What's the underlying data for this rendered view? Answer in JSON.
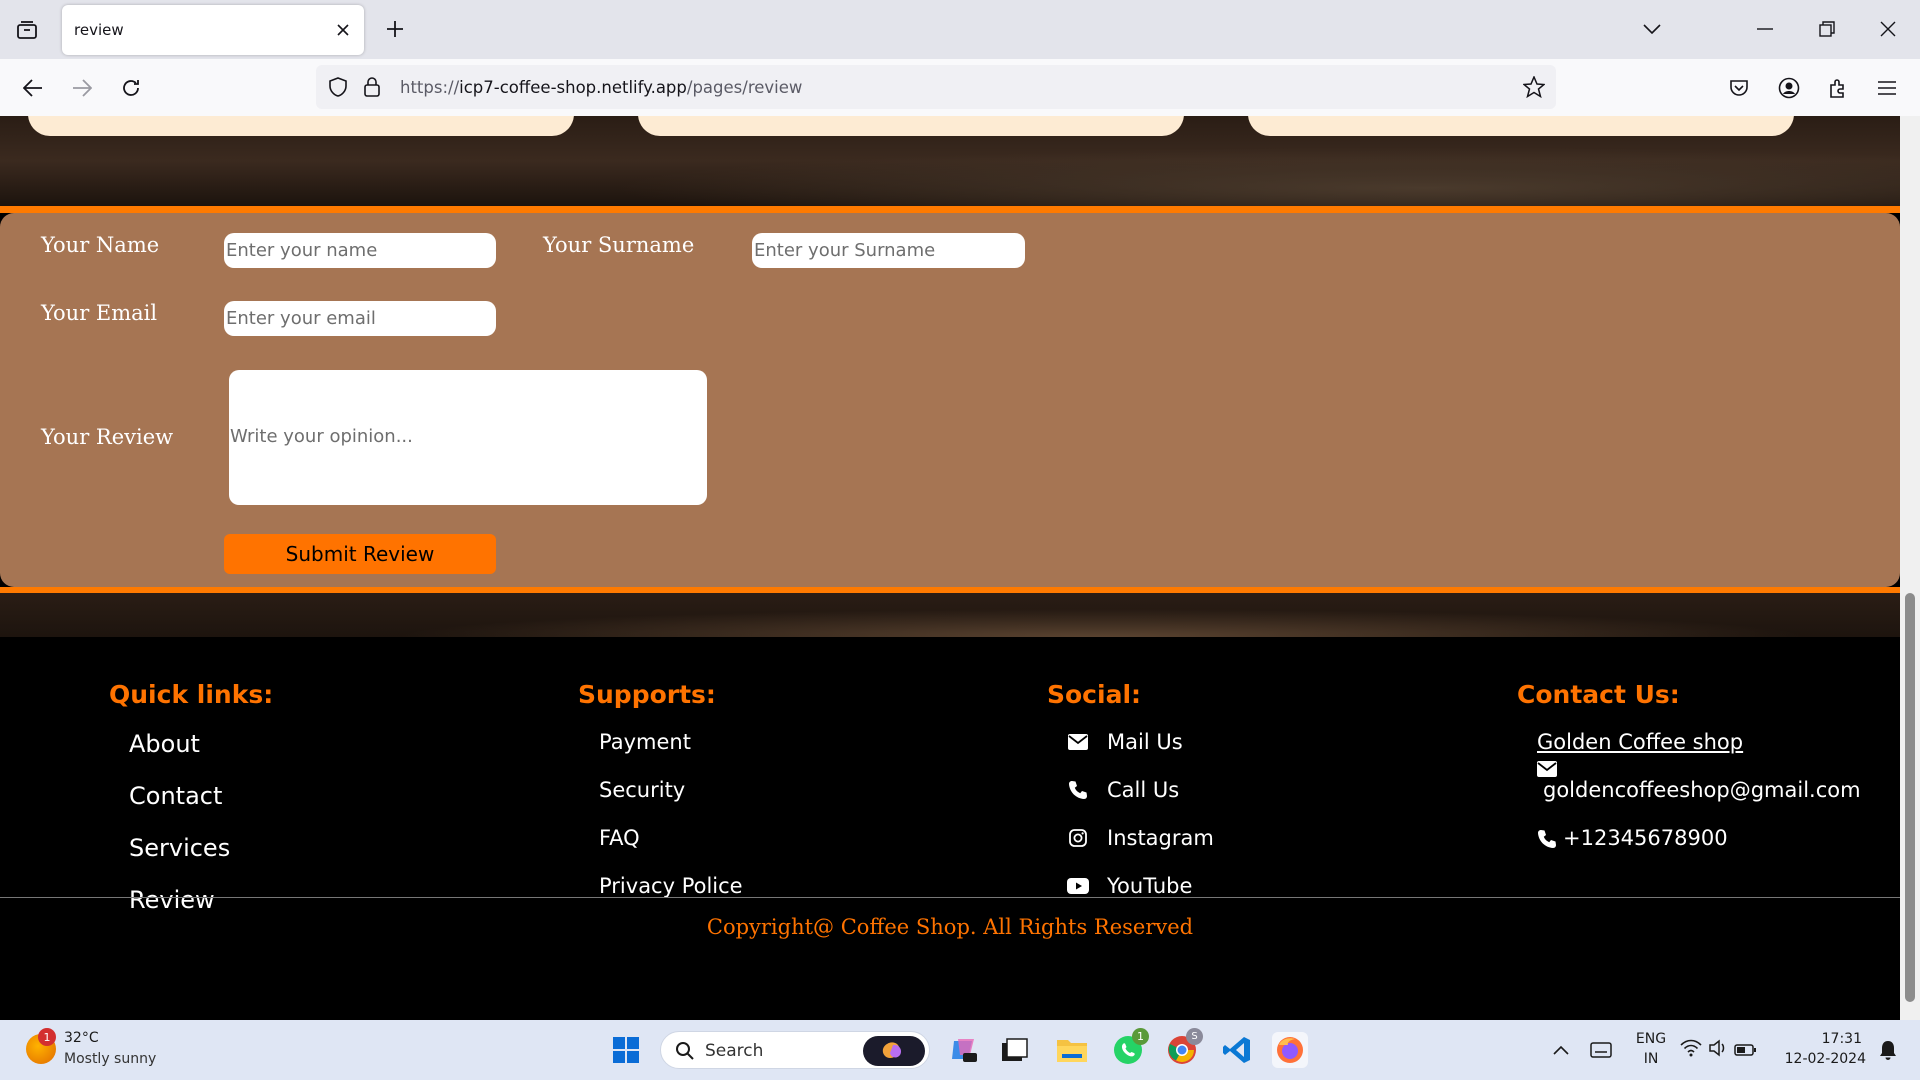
{
  "browser": {
    "tab_title": "review",
    "url_prefix": "https://",
    "url_host": "icp7-coffee-shop.netlify.app",
    "url_path": "/pages/review"
  },
  "form": {
    "name_label": "Your Name",
    "name_placeholder": "Enter your name",
    "surname_label": "Your Surname",
    "surname_placeholder": "Enter your Surname",
    "email_label": "Your Email",
    "email_placeholder": "Enter your email",
    "review_label": "Your Review",
    "review_placeholder": "Write your opinion...",
    "submit_label": "Submit Review"
  },
  "footer": {
    "quick_links": {
      "heading": "Quick links:",
      "items": [
        "About",
        "Contact",
        "Services",
        "Review"
      ]
    },
    "supports": {
      "heading": "Supports:",
      "items": [
        "Payment",
        "Security",
        "FAQ",
        "Privacy Police"
      ]
    },
    "social": {
      "heading": "Social:",
      "items": [
        {
          "label": "Mail Us",
          "icon": "envelope-icon"
        },
        {
          "label": "Call Us",
          "icon": "phone-icon"
        },
        {
          "label": "Instagram",
          "icon": "instagram-icon"
        },
        {
          "label": "YouTube",
          "icon": "youtube-icon"
        }
      ]
    },
    "contact": {
      "heading": "Contact Us:",
      "shop_name": "Golden Coffee shop",
      "email": "goldencoffeeshop@gmail.com",
      "phone": "+12345678900"
    },
    "copyright": "Copyright@ Coffee Shop. All Rights Reserved"
  },
  "taskbar": {
    "weather_temp": "32°C",
    "weather_desc": "Mostly sunny",
    "weather_badge": "1",
    "search_label": "Search",
    "lang_top": "ENG",
    "lang_bottom": "IN",
    "time": "17:31",
    "date": "12-02-2024",
    "whatsapp_badge": "1",
    "chrome_badge": "S"
  },
  "colors": {
    "accent_orange": "#ff7300",
    "form_panel": "#a67553",
    "footer_bg": "#000000"
  }
}
